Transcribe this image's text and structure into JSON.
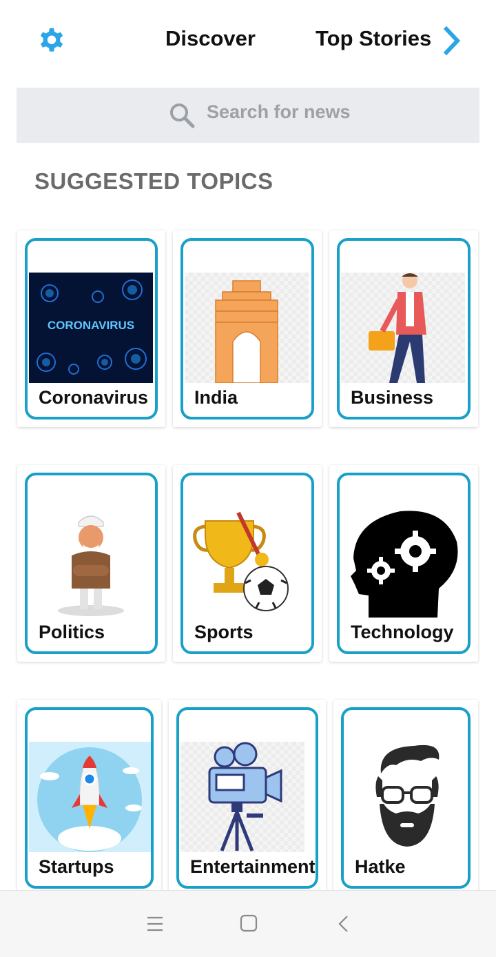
{
  "header": {
    "settings_icon": "gear-icon",
    "discover_label": "Discover",
    "top_stories_label": "Top Stories",
    "next_icon": "chevron-right-icon",
    "accent_color": "#2aa6e6"
  },
  "search": {
    "placeholder": "Search for news",
    "icon": "search-icon"
  },
  "section": {
    "title": "SUGGESTED TOPICS"
  },
  "topics": [
    {
      "label": "Coronavirus",
      "image_text": "CORONAVIRUS",
      "icon": "virus-image"
    },
    {
      "label": "India",
      "icon": "india-gate-image"
    },
    {
      "label": "Business",
      "icon": "businessman-image"
    },
    {
      "label": "Politics",
      "icon": "politician-image"
    },
    {
      "label": "Sports",
      "icon": "trophy-football-image"
    },
    {
      "label": "Technology",
      "icon": "head-gears-image"
    },
    {
      "label": "Startups",
      "icon": "rocket-image"
    },
    {
      "label": "Entertainment",
      "icon": "movie-camera-image"
    },
    {
      "label": "Hatke",
      "icon": "hipster-face-image"
    }
  ],
  "bottom_nav": {
    "menu_icon": "menu-icon",
    "home_icon": "home-square-icon",
    "back_icon": "back-chevron-icon"
  },
  "colors": {
    "card_border": "#1aa0c8",
    "search_bg": "#e9ebee",
    "section_title": "#6b6b6b"
  }
}
